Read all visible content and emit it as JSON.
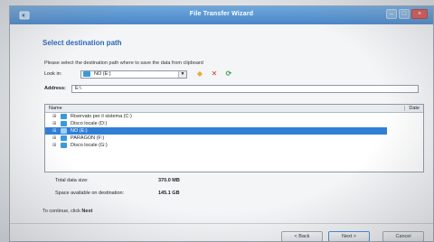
{
  "window": {
    "title": "File Transfer Wizard"
  },
  "page": {
    "heading": "Select destination path",
    "instructions": "Please select the destination path where to save the data from clipboard"
  },
  "look_in": {
    "label": "Look in:",
    "value": "NO (E:)"
  },
  "address": {
    "label": "Address:",
    "value": "E:\\"
  },
  "tree": {
    "columns": {
      "name": "Name",
      "date": "Date"
    },
    "items": [
      {
        "label": "Riservato per il sistema (C:)"
      },
      {
        "label": "Disco locale (D:)"
      },
      {
        "label": "NO (E:)"
      },
      {
        "label": "PARAGON (F:)"
      },
      {
        "label": "Disco locale (G:)"
      }
    ]
  },
  "info": {
    "total_label": "Total data size:",
    "total_value": "370.0 MB",
    "space_label": "Space available on destination:",
    "space_value": "145.1 GB"
  },
  "continue": {
    "prefix": "To continue, click",
    "action": "Next"
  },
  "buttons": {
    "back": "< Back",
    "next": "Next >",
    "cancel": "Cancel"
  },
  "colors": {
    "selection": "#2f7fd6",
    "title_bar": "#4a86c8",
    "heading": "#2a66b8"
  },
  "icons": {
    "app": "app-icon",
    "drive": "drive-icon",
    "new_folder": "new-folder-icon",
    "delete": "delete-icon",
    "refresh": "refresh-icon"
  }
}
